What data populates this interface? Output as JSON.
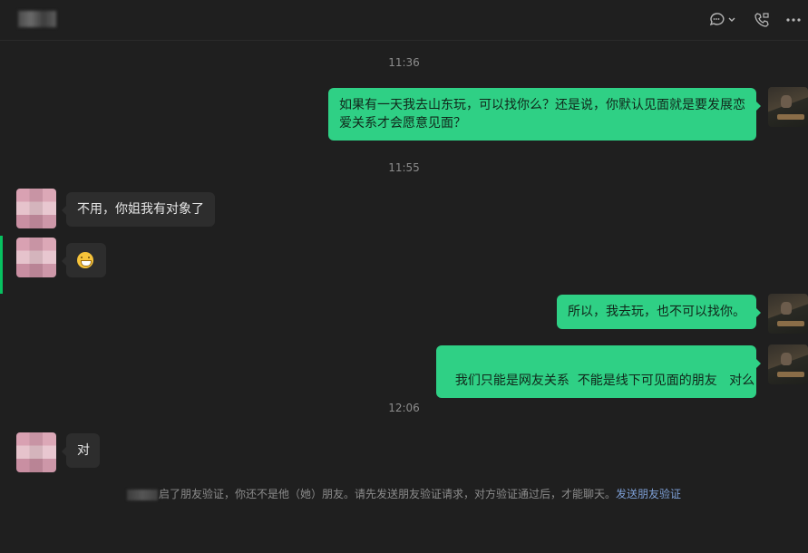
{
  "header": {
    "icons": [
      "chat-bubble-icon",
      "chevron-down-icon",
      "phone-video-icon",
      "more-icon"
    ]
  },
  "timestamps": [
    "11:36",
    "11:55",
    "12:06"
  ],
  "messages": [
    {
      "side": "me",
      "text": "如果有一天我去山东玩，可以找你么？还是说，你默认见面就是要发展恋爱关系才会愿意见面？"
    },
    {
      "side": "other",
      "text": "不用，你姐我有对象了"
    },
    {
      "side": "other",
      "emoji": "grinning-face-icon"
    },
    {
      "side": "me",
      "text": "所以，我去玩，也不可以找你。"
    },
    {
      "side": "me",
      "text": "我们只能是网友关系  不能是线下可见面的朋友   对么"
    },
    {
      "side": "other",
      "text": "对"
    }
  ],
  "notice": {
    "text": "启了朋友验证，你还不是他（她）朋友。请先发送朋友验证请求，对方验证通过后，才能聊天。",
    "link": "发送朋友验证"
  },
  "colors": {
    "bubble_me": "#2fd085",
    "bubble_other": "#2d2d2d",
    "background": "#1f1f1f",
    "link": "#7d9fd6"
  }
}
